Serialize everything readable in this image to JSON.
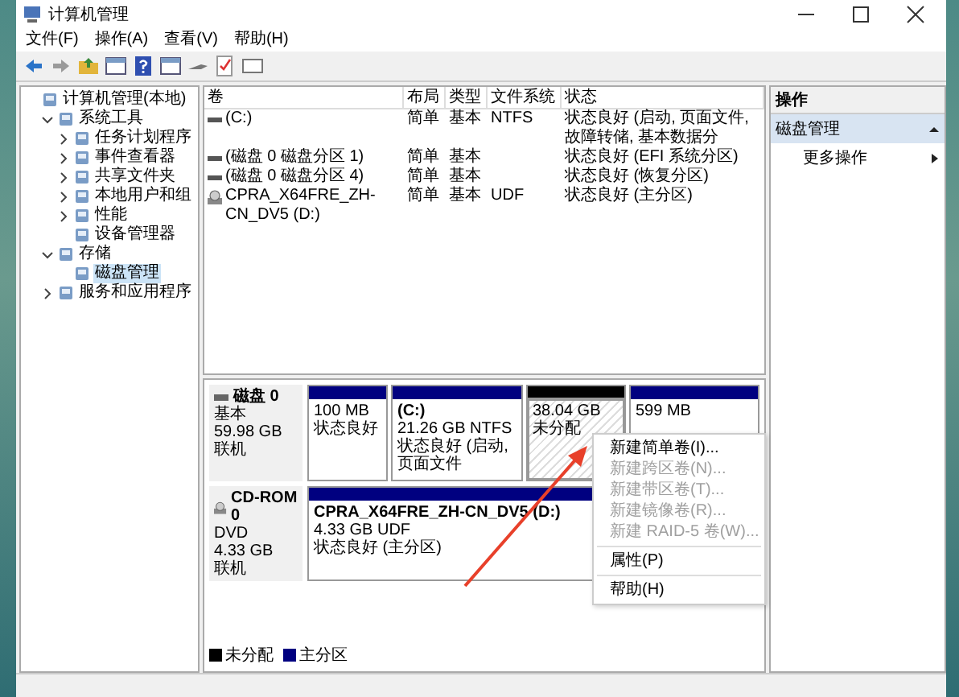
{
  "window": {
    "title": "计算机管理"
  },
  "menu": [
    "文件(F)",
    "操作(A)",
    "查看(V)",
    "帮助(H)"
  ],
  "tree": [
    {
      "label": "计算机管理(本地)",
      "selected": false,
      "children": [
        {
          "label": "系统工具",
          "expanded": true,
          "selected": false,
          "children": [
            {
              "label": "任务计划程序",
              "expanded": false,
              "selected": false
            },
            {
              "label": "事件查看器",
              "expanded": false,
              "selected": false
            },
            {
              "label": "共享文件夹",
              "expanded": false,
              "selected": false
            },
            {
              "label": "本地用户和组",
              "expanded": false,
              "selected": false
            },
            {
              "label": "性能",
              "expanded": false,
              "selected": false
            },
            {
              "label": "设备管理器",
              "selected": false
            }
          ]
        },
        {
          "label": "存储",
          "expanded": true,
          "selected": false,
          "children": [
            {
              "label": "磁盘管理",
              "selected": true
            }
          ]
        },
        {
          "label": "服务和应用程序",
          "expanded": false,
          "selected": false
        }
      ]
    }
  ],
  "volumes": {
    "columns": [
      "卷",
      "布局",
      "类型",
      "文件系统",
      "状态"
    ],
    "rows": [
      {
        "kind": "partition",
        "cells": [
          "(C:)",
          "简单",
          "基本",
          "NTFS",
          "状态良好 (启动, 页面文件, 故障转储, 基本数据分"
        ]
      },
      {
        "kind": "partition",
        "cells": [
          "(磁盘 0 磁盘分区 1)",
          "简单",
          "基本",
          "",
          "状态良好 (EFI 系统分区)"
        ]
      },
      {
        "kind": "partition",
        "cells": [
          "(磁盘 0 磁盘分区 4)",
          "简单",
          "基本",
          "",
          "状态良好 (恢复分区)"
        ]
      },
      {
        "kind": "cdrom",
        "cells": [
          "CPRA_X64FRE_ZH-CN_DV5 (D:)",
          "简单",
          "基本",
          "UDF",
          "状态良好 (主分区)"
        ]
      }
    ]
  },
  "disks": [
    {
      "kind": "disk",
      "name": "磁盘 0",
      "type": "基本",
      "size": "59.98 GB",
      "status": "联机",
      "partitions": [
        {
          "kind": "primary",
          "selected": false,
          "lines": [
            "100 MB",
            "状态良好"
          ]
        },
        {
          "kind": "primary",
          "selected": false,
          "title": "(C:)",
          "lines": [
            "21.26 GB NTFS",
            "状态良好 (启动, 页面文件"
          ]
        },
        {
          "kind": "unallocated",
          "selected": true,
          "lines": [
            "38.04 GB",
            "未分配"
          ]
        },
        {
          "kind": "primary",
          "selected": false,
          "lines": [
            "599 MB"
          ]
        }
      ]
    },
    {
      "kind": "cdrom",
      "name": "CD-ROM 0",
      "type": "DVD",
      "size": "4.33 GB",
      "status": "联机",
      "partitions": [
        {
          "kind": "primary",
          "selected": false,
          "title": "CPRA_X64FRE_ZH-CN_DV5  (D:)",
          "lines": [
            "4.33 GB UDF",
            "状态良好 (主分区)"
          ]
        }
      ]
    }
  ],
  "legend": [
    {
      "label": "未分配",
      "color": "#000000"
    },
    {
      "label": "主分区",
      "color": "#000080"
    }
  ],
  "context_menu": [
    {
      "kind": "item",
      "label": "新建简单卷(I)...",
      "disabled": false
    },
    {
      "kind": "item",
      "label": "新建跨区卷(N)...",
      "disabled": true
    },
    {
      "kind": "item",
      "label": "新建带区卷(T)...",
      "disabled": true
    },
    {
      "kind": "item",
      "label": "新建镜像卷(R)...",
      "disabled": true
    },
    {
      "kind": "item",
      "label": "新建 RAID-5 卷(W)...",
      "disabled": true
    },
    {
      "kind": "separator"
    },
    {
      "kind": "item",
      "label": "属性(P)",
      "disabled": false
    },
    {
      "kind": "separator"
    },
    {
      "kind": "item",
      "label": "帮助(H)",
      "disabled": false
    }
  ],
  "actions": {
    "title": "操作",
    "sections": [
      {
        "label": "磁盘管理",
        "expanded": true,
        "items": [
          "更多操作"
        ]
      }
    ]
  }
}
